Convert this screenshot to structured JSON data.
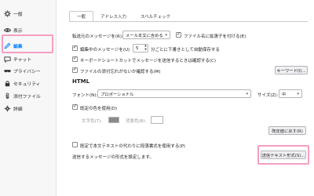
{
  "sidebar": {
    "items": [
      {
        "label": "一般",
        "icon": "gear-icon"
      },
      {
        "label": "表示",
        "icon": "eye-icon"
      },
      {
        "label": "編集",
        "icon": "pencil-icon",
        "selected": true
      },
      {
        "label": "チャット",
        "icon": "chat-icon"
      },
      {
        "label": "プライバシー",
        "icon": "mask-icon"
      },
      {
        "label": "セキュリティ",
        "icon": "lock-icon"
      },
      {
        "label": "添付ファイル",
        "icon": "paperclip-icon"
      },
      {
        "label": "詳細",
        "icon": "advanced-gear-icon"
      }
    ],
    "accent_color": "#0a84ff",
    "highlight_color": "#f59ec1"
  },
  "tabs": [
    "一般",
    "アドレス入力",
    "スペルチェック"
  ],
  "general": {
    "forward_label": "転送元のメッセージを(R):",
    "forward_value": "メール本文に含める",
    "ext_label": "ファイル名に拡張子を付ける(E)",
    "ext_checked": true,
    "autosave_prefix": "編集中のメッセージを(U)",
    "autosave_value": "5",
    "autosave_suffix": "分ごとに下書きとして自動保存する",
    "autosave_checked": true,
    "modifier_label": "キーボードショートカットでメッセージを送信するときは確認する(C)",
    "modifier_checked": true,
    "attach_label": "ファイルの添付忘れがないか確認する(M)",
    "attach_checked": true,
    "keywords_button": "キーワード(I)..."
  },
  "html": {
    "heading": "HTML",
    "font_label": "フォント(N):",
    "font_value": "プロポーショナル",
    "size_label": "サイズ(Z):",
    "size_value": "中",
    "reader_colors_label": "既定の色を使用(D)",
    "reader_colors_checked": true,
    "text_color_label": "文字色(T):",
    "bg_color_label": "背景色(B):",
    "text_color": "#8a8a8a",
    "bg_color": "#ffffff",
    "restore_button": "既定値に戻す(R)"
  },
  "bottom": {
    "paragraph_label": "既定で本文テキストの代わりに段落書式を使用する(P)",
    "paragraph_checked": false,
    "send_format_label": "送信するメッセージの形式を設定します。",
    "send_format_button": "送信テキスト形式(S)..."
  }
}
